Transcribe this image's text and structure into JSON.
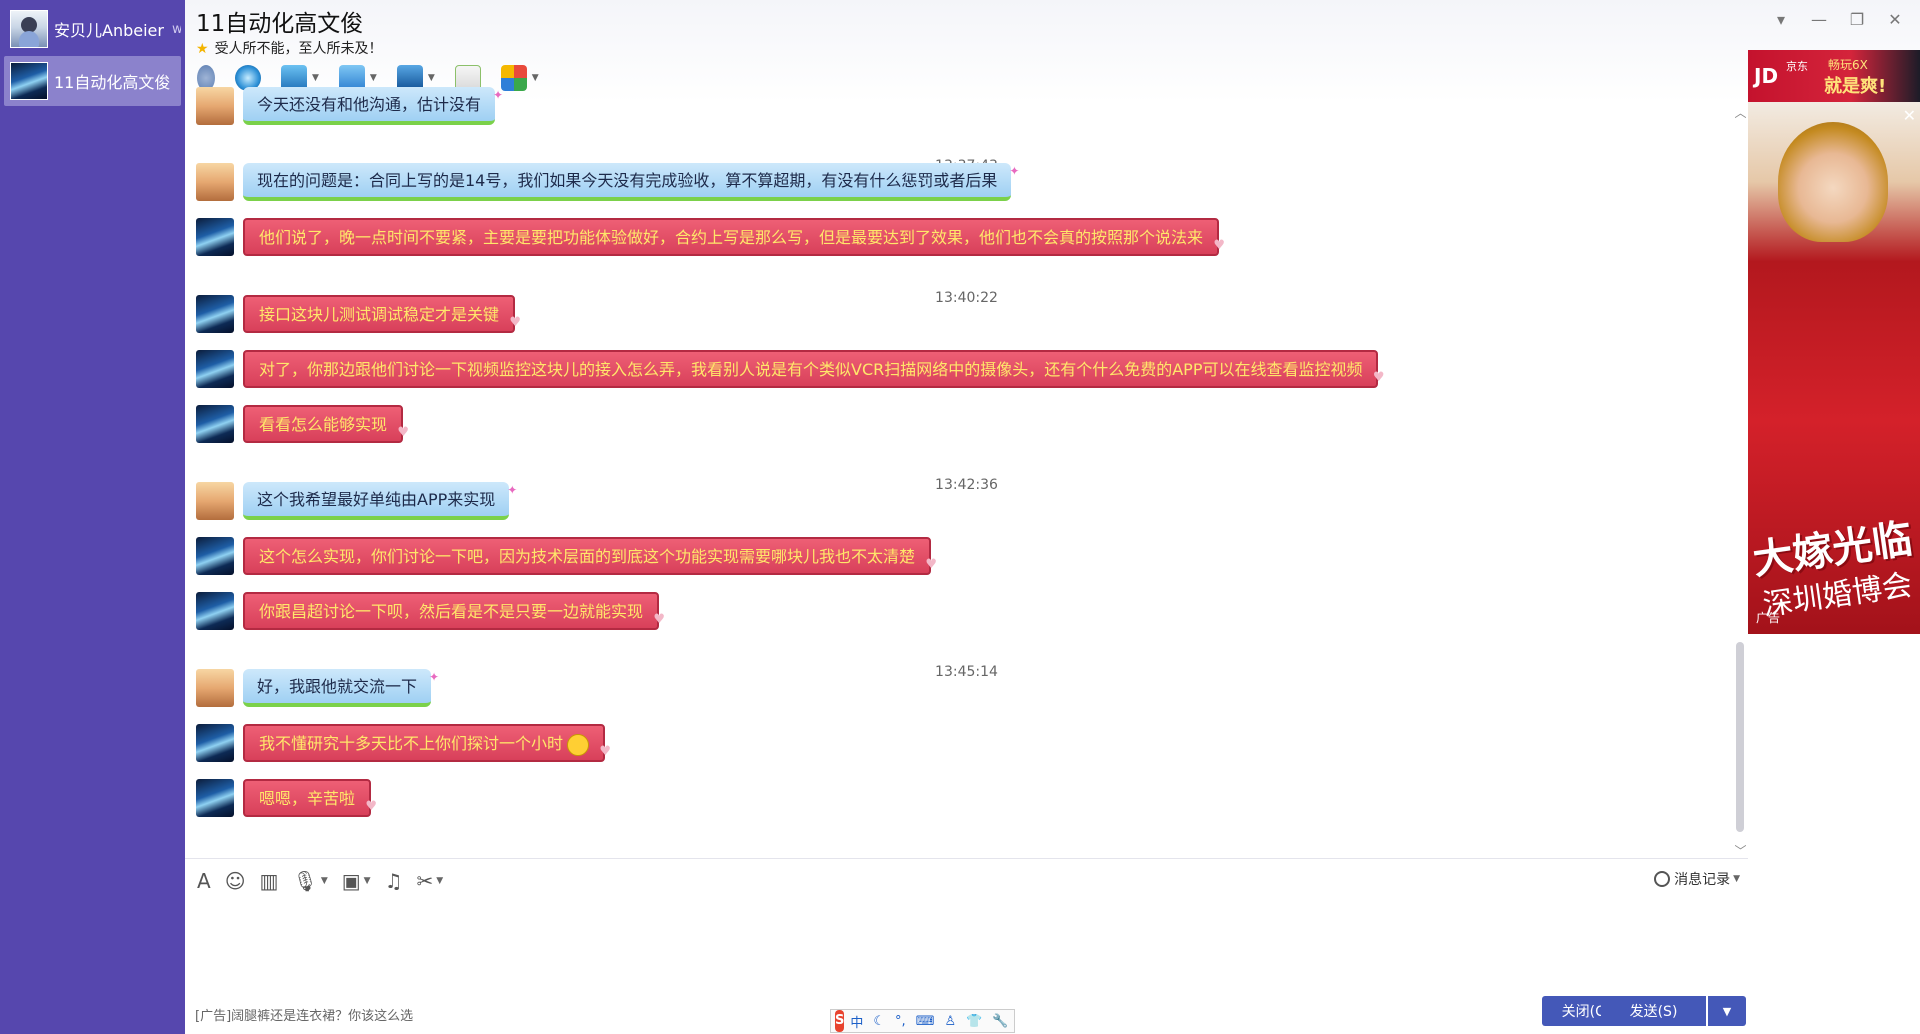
{
  "sidebar": {
    "contacts": [
      {
        "name": "安贝儿Anbeier",
        "suffix": "we"
      },
      {
        "name": "11自动化高文俊"
      }
    ]
  },
  "header": {
    "title": "11自动化高文俊",
    "signature": "受人所不能，至人所未及！",
    "star": "★"
  },
  "window_controls": {
    "menu": "▾",
    "minimize": "—",
    "restore": "❐",
    "close": "✕"
  },
  "messages": [
    {
      "kind": "msg",
      "sender": "contact",
      "text": "今天还没有和他沟通，估计没有"
    },
    {
      "kind": "time",
      "text": "13:37:43"
    },
    {
      "kind": "msg",
      "sender": "contact",
      "text": "现在的问题是：合同上写的是14号，我们如果今天没有完成验收，算不算超期，有没有什么惩罚或者后果"
    },
    {
      "kind": "msg",
      "sender": "me",
      "text": "他们说了，晚一点时间不要紧，主要是要把功能体验做好，合约上写是那么写，但是最要达到了效果，他们也不会真的按照那个说法来"
    },
    {
      "kind": "time",
      "text": "13:40:22"
    },
    {
      "kind": "msg",
      "sender": "me",
      "text": "接口这块儿测试调试稳定才是关键"
    },
    {
      "kind": "msg",
      "sender": "me",
      "text": "对了，你那边跟他们讨论一下视频监控这块儿的接入怎么弄，我看别人说是有个类似VCR扫描网络中的摄像头，还有个什么免费的APP可以在线查看监控视频"
    },
    {
      "kind": "msg",
      "sender": "me",
      "text": "看看怎么能够实现"
    },
    {
      "kind": "time",
      "text": "13:42:36"
    },
    {
      "kind": "msg",
      "sender": "contact",
      "text": "这个我希望最好单纯由APP来实现"
    },
    {
      "kind": "msg",
      "sender": "me",
      "text": "这个怎么实现，你们讨论一下吧，因为技术层面的到底这个功能实现需要哪块儿我也不太清楚"
    },
    {
      "kind": "msg",
      "sender": "me",
      "text": "你跟昌超讨论一下呗，然后看是不是只要一边就能实现"
    },
    {
      "kind": "time",
      "text": "13:45:14"
    },
    {
      "kind": "msg",
      "sender": "contact",
      "text": "好，我跟他就交流一下"
    },
    {
      "kind": "msg",
      "sender": "me",
      "text": "我不懂研究十多天比不上你们探讨一个小时",
      "emoji": true
    },
    {
      "kind": "msg",
      "sender": "me",
      "text": "嗯嗯，辛苦啦"
    }
  ],
  "input": {
    "tools": [
      "A",
      "☺",
      "▥",
      "🎙",
      "▣",
      "♫",
      "✂"
    ],
    "history_label": "消息记录",
    "ad_text": "[广告]阔腿裤还是连衣裙？你该这么选",
    "ime_logo": "S",
    "ime_items": [
      "中",
      "☾",
      "°,",
      "⌨",
      "♙",
      "👕",
      "🔧"
    ],
    "close_label": "关闭(C)",
    "send_label": "发送(S)",
    "send_drop": "▼"
  },
  "ad": {
    "brand": "JD",
    "brand_sub": "京东",
    "slogan_small": "畅玩6X",
    "slogan_big": "就是爽!",
    "big_line1": "大嫁光临",
    "big_line2": "深圳婚博会",
    "label": "广告",
    "close": "✕"
  },
  "colors": {
    "sidebar_bg": "#5647ae",
    "bubble_contact": "#a8d5f5",
    "bubble_me": "#e04a62",
    "me_text": "#ffe76a",
    "button": "#4458b8"
  }
}
